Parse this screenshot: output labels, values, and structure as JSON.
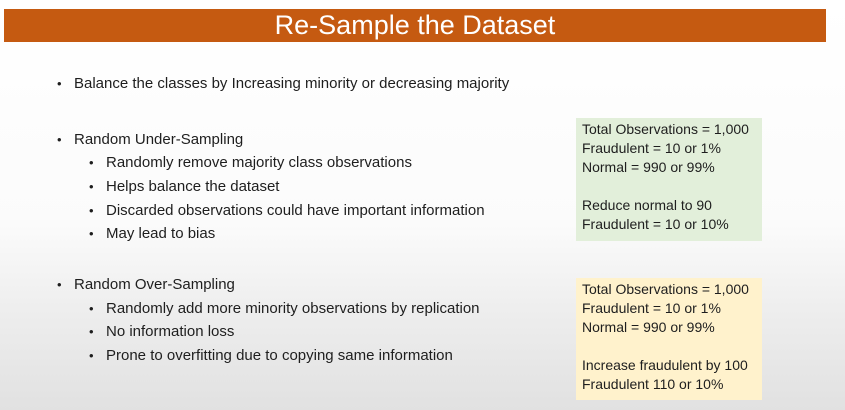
{
  "title": "Re-Sample the Dataset",
  "intro_bullet": "Balance the classes by Increasing minority or decreasing majority",
  "bullet_glyph": "•",
  "under_sampling": {
    "heading": "Random Under-Sampling",
    "items": [
      "Randomly remove majority class observations",
      "Helps balance the dataset",
      "Discarded observations could have important information",
      "May lead to bias"
    ]
  },
  "over_sampling": {
    "heading": "Random Over-Sampling",
    "items": [
      "Randomly add more minority observations by replication",
      "No information loss",
      "Prone to overfitting due to copying same information"
    ]
  },
  "under_box": {
    "lines": [
      "Total Observations = 1,000",
      "Fraudulent = 10 or 1%",
      "Normal = 990 or 99%"
    ],
    "result_lines": [
      "Reduce normal to 90",
      "Fraudulent = 10 or 10%"
    ]
  },
  "over_box": {
    "lines": [
      "Total Observations = 1,000",
      "Fraudulent = 10 or 1%",
      "Normal = 990 or 99%"
    ],
    "result_lines": [
      "Increase fraudulent by 100",
      "Fraudulent 110 or 10%"
    ]
  },
  "colors": {
    "title_bar": "#c55a11",
    "title_text": "#ffffff",
    "under_box_bg": "#e2efda",
    "over_box_bg": "#fff2cc"
  }
}
